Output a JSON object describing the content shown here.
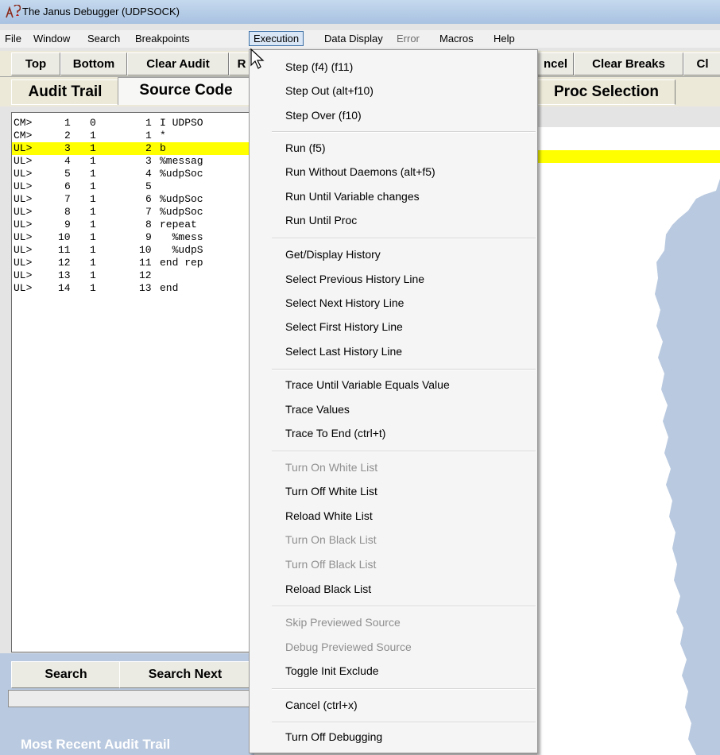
{
  "window": {
    "title": "The Janus Debugger (UDPSOCK)"
  },
  "menubar": [
    {
      "label": "File",
      "state": "normal"
    },
    {
      "label": "Window",
      "state": "normal"
    },
    {
      "label": "Search",
      "state": "normal"
    },
    {
      "label": "Breakpoints",
      "state": "normal"
    },
    {
      "label": "Execution",
      "state": "active"
    },
    {
      "label": "Data Display",
      "state": "normal"
    },
    {
      "label": "Error",
      "state": "disabled"
    },
    {
      "label": "Macros",
      "state": "normal"
    },
    {
      "label": "Help",
      "state": "normal"
    }
  ],
  "toolbar": {
    "buttons": [
      "Top",
      "Bottom",
      "Clear Audit",
      "R",
      "ncel",
      "Clear Breaks",
      "Cl"
    ]
  },
  "tabs": {
    "items": [
      "Audit Trail",
      "Source Code",
      "Proc Selection"
    ]
  },
  "source": {
    "lines": [
      {
        "prefix": "CM>",
        "n1": "1",
        "n2": "0",
        "n3": "1",
        "code": "I UDPSO",
        "highlight": false
      },
      {
        "prefix": "CM>",
        "n1": "2",
        "n2": "1",
        "n3": "1",
        "code": "*",
        "highlight": false
      },
      {
        "prefix": "UL>",
        "n1": "3",
        "n2": "1",
        "n3": "2",
        "code": "b",
        "highlight": true
      },
      {
        "prefix": "UL>",
        "n1": "4",
        "n2": "1",
        "n3": "3",
        "code": "%messag",
        "highlight": false
      },
      {
        "prefix": "UL>",
        "n1": "5",
        "n2": "1",
        "n3": "4",
        "code": "%udpSoc",
        "highlight": false
      },
      {
        "prefix": "UL>",
        "n1": "6",
        "n2": "1",
        "n3": "5",
        "code": "",
        "highlight": false
      },
      {
        "prefix": "UL>",
        "n1": "7",
        "n2": "1",
        "n3": "6",
        "code": "%udpSoc",
        "highlight": false
      },
      {
        "prefix": "UL>",
        "n1": "8",
        "n2": "1",
        "n3": "7",
        "code": "%udpSoc",
        "highlight": false
      },
      {
        "prefix": "UL>",
        "n1": "9",
        "n2": "1",
        "n3": "8",
        "code": "repeat",
        "highlight": false
      },
      {
        "prefix": "UL>",
        "n1": "10",
        "n2": "1",
        "n3": "9",
        "code": "  %mess",
        "highlight": false
      },
      {
        "prefix": "UL>",
        "n1": "11",
        "n2": "1",
        "n3": "10",
        "code": "  %udpS",
        "highlight": false
      },
      {
        "prefix": "UL>",
        "n1": "12",
        "n2": "1",
        "n3": "11",
        "code": "end rep",
        "highlight": false
      },
      {
        "prefix": "UL>",
        "n1": "13",
        "n2": "1",
        "n3": "12",
        "code": "",
        "highlight": false
      },
      {
        "prefix": "UL>",
        "n1": "14",
        "n2": "1",
        "n3": "13",
        "code": "end",
        "highlight": false
      }
    ]
  },
  "bottom": {
    "search_label": "Search",
    "search_next_label": "Search Next",
    "status_label": "Most Recent Audit Trail"
  },
  "execution_menu": {
    "groups": [
      [
        {
          "label": "Step (f4) (f11)",
          "enabled": true
        },
        {
          "label": "Step Out (alt+f10)",
          "enabled": true
        },
        {
          "label": "Step Over (f10)",
          "enabled": true
        }
      ],
      [
        {
          "label": "Run (f5)",
          "enabled": true
        },
        {
          "label": "Run Without Daemons (alt+f5)",
          "enabled": true
        },
        {
          "label": "Run Until Variable changes",
          "enabled": true
        },
        {
          "label": "Run Until Proc",
          "enabled": true
        }
      ],
      [
        {
          "label": "Get/Display History",
          "enabled": true
        },
        {
          "label": "Select Previous History Line",
          "enabled": true
        },
        {
          "label": "Select Next History Line",
          "enabled": true
        },
        {
          "label": "Select First History Line",
          "enabled": true
        },
        {
          "label": "Select Last History Line",
          "enabled": true
        }
      ],
      [
        {
          "label": "Trace Until Variable Equals Value",
          "enabled": true
        },
        {
          "label": "Trace Values",
          "enabled": true
        },
        {
          "label": "Trace To End (ctrl+t)",
          "enabled": true
        }
      ],
      [
        {
          "label": "Turn On White List",
          "enabled": false
        },
        {
          "label": "Turn Off White List",
          "enabled": true
        },
        {
          "label": "Reload White List",
          "enabled": true
        },
        {
          "label": "Turn On Black List",
          "enabled": false
        },
        {
          "label": "Turn Off Black List",
          "enabled": false
        },
        {
          "label": "Reload Black List",
          "enabled": true
        }
      ],
      [
        {
          "label": "Skip Previewed Source",
          "enabled": false
        },
        {
          "label": "Debug Previewed Source",
          "enabled": false
        },
        {
          "label": "Toggle Init Exclude",
          "enabled": true
        }
      ],
      [
        {
          "label": "Cancel (ctrl+x)",
          "enabled": true
        }
      ],
      [
        {
          "label": "Turn Off Debugging",
          "enabled": true
        }
      ]
    ]
  },
  "icons": {
    "app": "debugger-bug-icon",
    "cursor": "mouse-pointer-icon"
  },
  "colors": {
    "highlight": "#ffff00",
    "disabled_text": "#8f8f8f",
    "bottom_panel": "#b9c9df"
  }
}
